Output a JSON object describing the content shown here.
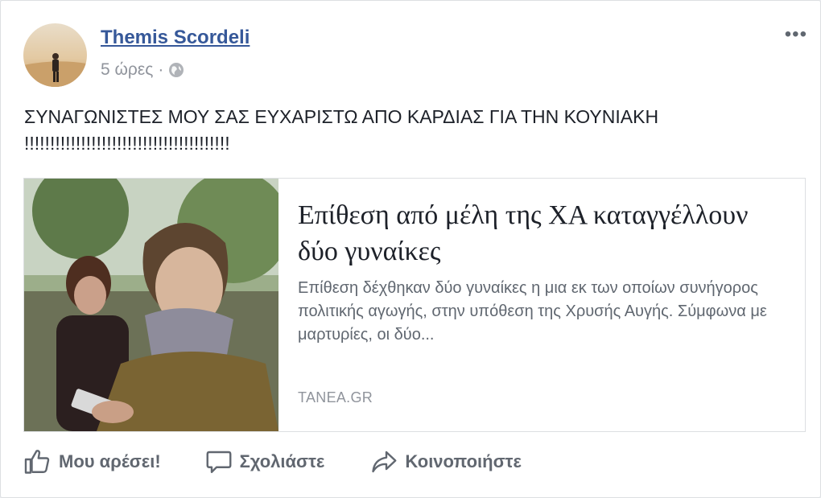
{
  "post": {
    "author": "Themis Scordeli",
    "time": "5 ώρες",
    "separator": "·",
    "privacy_icon": "globe-icon",
    "more_icon": "more-options-icon",
    "more_label": "•••",
    "text_line1": "ΣΥΝΑΓΩΝΙΣΤΕΣ ΜΟΥ ΣΑΣ ΕΥΧΑΡΙΣΤΩ ΑΠΟ ΚΑΡΔΙΑΣ ΓΙΑ ΤΗΝ ΚΟΥΝΙΑΚΗ",
    "text_line2": "!!!!!!!!!!!!!!!!!!!!!!!!!!!!!!!!!!!!!!!!"
  },
  "link": {
    "title": "Επίθεση από μέλη της ΧΑ καταγγέλλουν δύο γυναίκες",
    "description": "Επίθεση δέχθηκαν δύο γυναίκες η μια εκ των οποίων συνήγορος πολιτικής αγωγής, στην υπόθεση της Χρυσής Αυγής. Σύμφωνα με μαρτυρίες, οι δύο...",
    "source": "TANEA.GR"
  },
  "actions": {
    "like": "Μου αρέσει!",
    "comment": "Σχολιάστε",
    "share": "Κοινοποιήστε"
  },
  "colors": {
    "author_link": "#365899",
    "secondary_text": "#90949c",
    "action_text": "#616770"
  }
}
